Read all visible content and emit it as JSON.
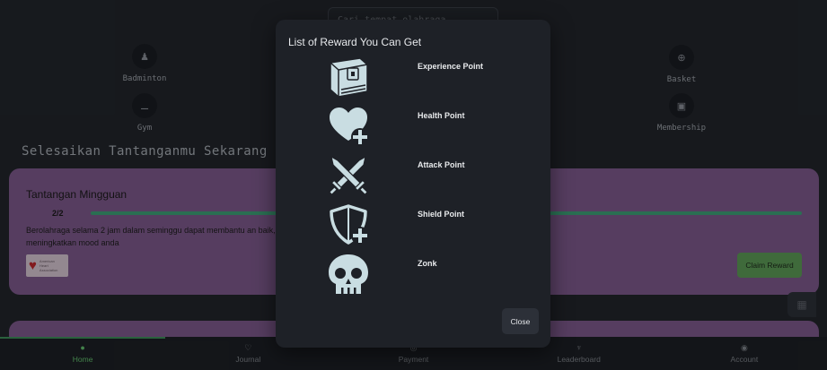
{
  "search": {
    "placeholder": "Cari tempat olahraga"
  },
  "categories": [
    {
      "label": "Badminton",
      "icon": "shuttlecock-icon"
    },
    {
      "label": "Basket",
      "icon": "basketball-icon"
    },
    {
      "label": "Gym",
      "icon": "dumbbell-icon"
    },
    {
      "label": "Membership",
      "icon": "id-card-icon"
    }
  ],
  "section_title": "Selesaikan Tantanganmu Sekarang",
  "challenge": {
    "title": "Tantangan Mingguan",
    "progress_text": "2/2",
    "progress_fraction": 1.0,
    "description": "Berolahraga selama 2 jam dalam seminggu dapat membantu an baik, dan meningkatkan mood anda",
    "sponsor_logo": "American Heart Association",
    "claim_label": "Claim Reward"
  },
  "modal": {
    "title": "List of Reward You Can Get",
    "rewards": [
      {
        "name": "Experience Point",
        "icon": "book-icon"
      },
      {
        "name": "Health Point",
        "icon": "heart-plus-icon"
      },
      {
        "name": "Attack Point",
        "icon": "crossed-swords-icon"
      },
      {
        "name": "Shield Point",
        "icon": "shield-plus-icon"
      },
      {
        "name": "Zonk",
        "icon": "skull-icon"
      }
    ],
    "close_label": "Close",
    "icon_color": "#c9dde2"
  },
  "nav": [
    {
      "label": "Home",
      "icon": "home-icon",
      "active": true
    },
    {
      "label": "Journal",
      "icon": "journal-icon",
      "active": false
    },
    {
      "label": "Payment",
      "icon": "payment-icon",
      "active": false
    },
    {
      "label": "Leaderboard",
      "icon": "trophy-icon",
      "active": false
    },
    {
      "label": "Account",
      "icon": "account-icon",
      "active": false
    }
  ],
  "colors": {
    "accent_green": "#64c06f",
    "card_purple": "#7f5a8e",
    "background": "#22262c"
  }
}
